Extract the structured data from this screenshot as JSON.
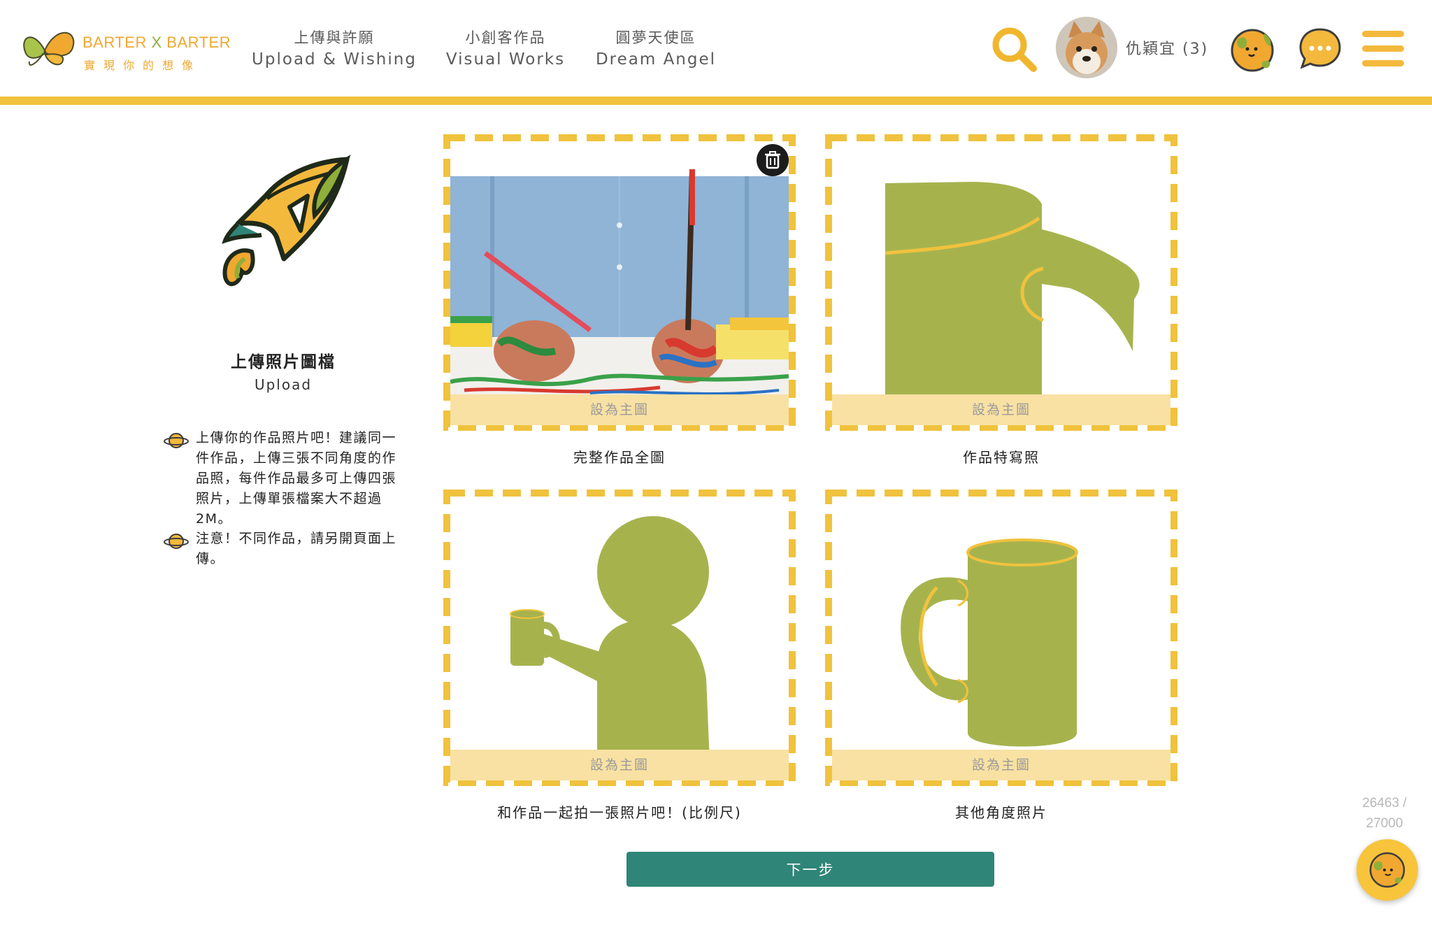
{
  "header": {
    "logo_en_left": "BARTER",
    "logo_en_x": "X",
    "logo_en_right": "BARTER",
    "logo_zh": "實現你的想像",
    "nav": [
      {
        "zh": "上傳與許願",
        "en": "Upload & Wishing"
      },
      {
        "zh": "小創客作品",
        "en": "Visual Works"
      },
      {
        "zh": "圓夢天使區",
        "en": "Dream Angel"
      }
    ],
    "user_name": "仇穎宜 (3)",
    "icons": [
      "search-icon",
      "avatar",
      "planet-mascot-icon",
      "chat-icon",
      "menu-icon"
    ]
  },
  "upload_panel": {
    "title": "上傳照片圖檔",
    "subtitle": "Upload",
    "tips": [
      "上傳你的作品照片吧！建議同一件作品，上傳三張不同角度的作品照，每件作品最多可上傳四張照片，上傳單張檔案大不超過2M。",
      "注意！不同作品，請另開頁面上傳。"
    ]
  },
  "cards": [
    {
      "caption": "完整作品全圖",
      "button": "設為主圖",
      "has_photo": true
    },
    {
      "caption": "作品特寫照",
      "button": "設為主圖",
      "has_photo": false
    },
    {
      "caption": "和作品一起拍一張照片吧！(比例尺)",
      "button": "設為主圖",
      "has_photo": false
    },
    {
      "caption": "其他角度照片",
      "button": "設為主圖",
      "has_photo": false
    }
  ],
  "footer": {
    "next_label": "下一步",
    "counter_line1": "26463 /",
    "counter_line2": "27000"
  },
  "colors": {
    "accent_yellow": "#f0c23d",
    "placeholder_green": "#a6b34d",
    "button_teal": "#2f8577",
    "set_main_bg": "#f8e1a3"
  }
}
